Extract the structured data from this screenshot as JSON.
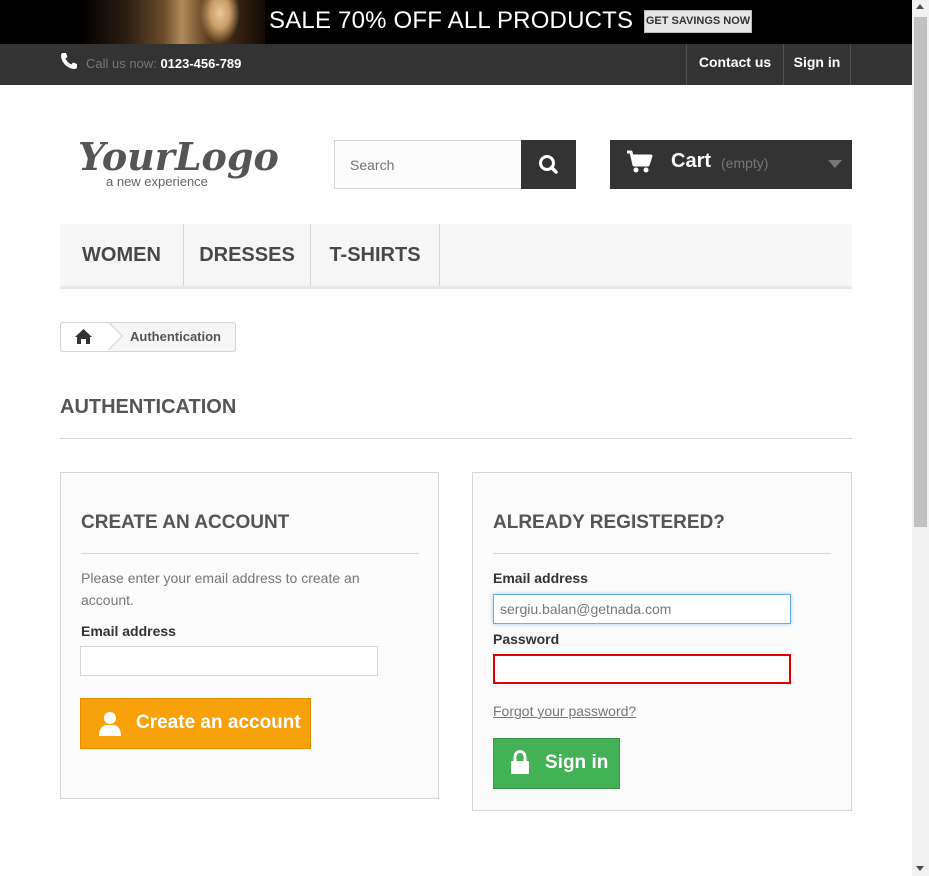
{
  "banner": {
    "headline": "SALE 70% OFF ALL PRODUCTS",
    "button_label": "GET SAVINGS NOW"
  },
  "topnav": {
    "call_prefix": "Call us now:",
    "phone": "0123-456-789",
    "contact_label": "Contact us",
    "signin_label": "Sign in"
  },
  "header": {
    "logo_text": "YourLogo",
    "logo_tagline": "a new experience",
    "search_placeholder": "Search",
    "cart_label": "Cart",
    "cart_status": "(empty)"
  },
  "menu": {
    "items": [
      {
        "label": "WOMEN"
      },
      {
        "label": "DRESSES"
      },
      {
        "label": "T-SHIRTS"
      }
    ]
  },
  "breadcrumb": {
    "current": "Authentication"
  },
  "page_title": "AUTHENTICATION",
  "create_account": {
    "heading": "CREATE AN ACCOUNT",
    "intro": "Please enter your email address to create an account.",
    "email_label": "Email address",
    "email_value": "",
    "button_label": "Create an account"
  },
  "login": {
    "heading": "ALREADY REGISTERED?",
    "email_label": "Email address",
    "email_value": "sergiu.balan@getnada.com",
    "password_label": "Password",
    "password_value": "",
    "forgot_label": "Forgot your password?",
    "button_label": "Sign in"
  },
  "colors": {
    "create_button": "#f7a20b",
    "signin_button": "#43b155",
    "error_border": "#e20000",
    "focus_border": "#66afe9",
    "dark_bar": "#333333"
  }
}
